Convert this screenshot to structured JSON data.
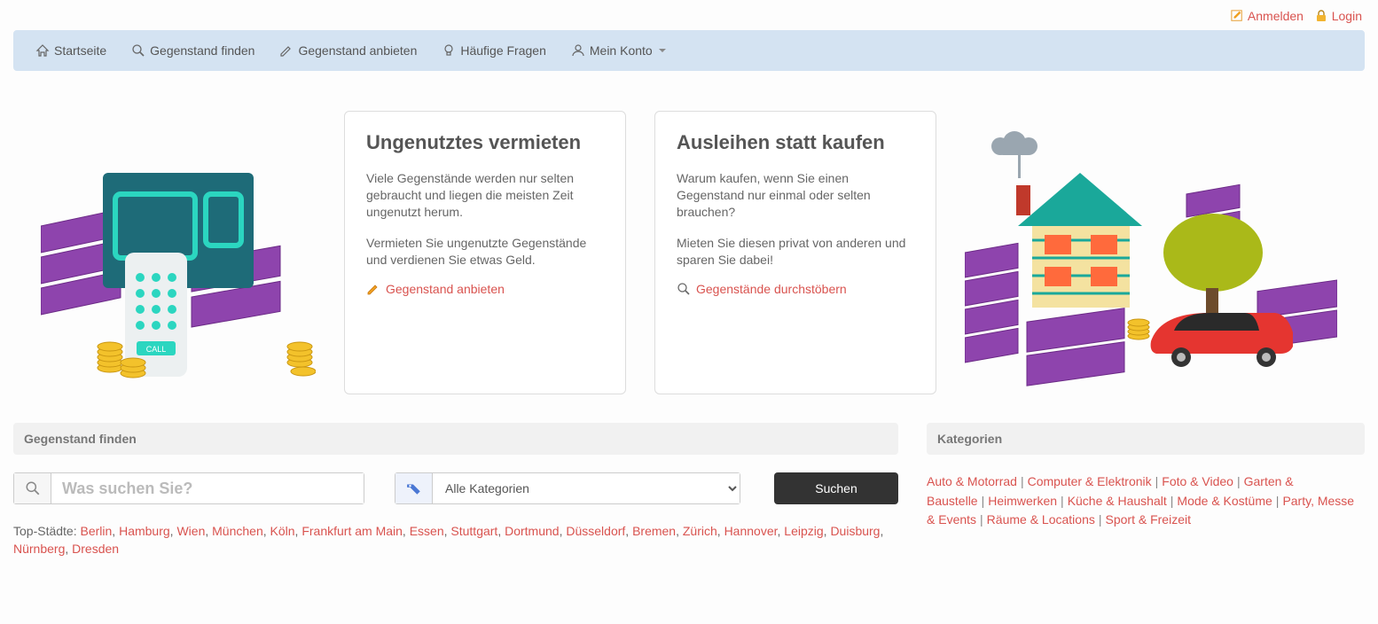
{
  "top": {
    "anmelden": "Anmelden",
    "login": "Login"
  },
  "nav": {
    "home": "Startseite",
    "find": "Gegenstand finden",
    "offer": "Gegenstand anbieten",
    "faq": "Häufige Fragen",
    "account": "Mein Konto"
  },
  "hero": {
    "left": {
      "title": "Ungenutztes vermieten",
      "p1": "Viele Gegenstände werden nur selten gebraucht und liegen die meisten Zeit ungenutzt herum.",
      "p2": "Vermieten Sie ungenutzte Gegenstände und verdienen Sie etwas Geld.",
      "link": "Gegenstand anbieten"
    },
    "right": {
      "title": "Ausleihen statt kaufen",
      "p1": "Warum kaufen, wenn Sie einen Gegenstand nur einmal oder selten brauchen?",
      "p2": "Mieten Sie diesen privat von anderen und sparen Sie dabei!",
      "link": "Gegenstände durchstöbern"
    }
  },
  "search": {
    "header": "Gegenstand finden",
    "placeholder": "Was suchen Sie?",
    "all_categories": "Alle Kategorien",
    "button": "Suchen",
    "cities_label": "Top-Städte:",
    "cities": [
      "Berlin",
      "Hamburg",
      "Wien",
      "München",
      "Köln",
      "Frankfurt am Main",
      "Essen",
      "Stuttgart",
      "Dortmund",
      "Düsseldorf",
      "Bremen",
      "Zürich",
      "Hannover",
      "Leipzig",
      "Duisburg",
      "Nürnberg",
      "Dresden"
    ]
  },
  "categories": {
    "header": "Kategorien",
    "items": [
      "Auto & Motorrad",
      "Computer & Elektronik",
      "Foto & Video",
      "Garten & Baustelle",
      "Heimwerken",
      "Küche & Haushalt",
      "Mode & Kostüme",
      "Party, Messe & Events",
      "Räume & Locations",
      "Sport & Freizeit"
    ]
  },
  "icons": {
    "home": "home-icon",
    "search": "search-icon",
    "pencil": "pencil-icon",
    "bulb": "bulb-icon",
    "user": "user-icon",
    "edit": "edit-icon",
    "lock": "lock-icon",
    "tag": "tag-icon"
  }
}
